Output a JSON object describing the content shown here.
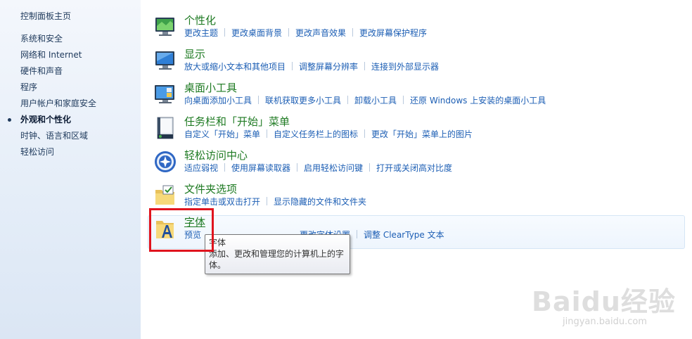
{
  "sidebar": {
    "home": "控制面板主页",
    "items": [
      {
        "label": "系统和安全"
      },
      {
        "label": "网络和 Internet"
      },
      {
        "label": "硬件和声音"
      },
      {
        "label": "程序"
      },
      {
        "label": "用户帐户和家庭安全"
      },
      {
        "label": "外观和个性化"
      },
      {
        "label": "时钟、语言和区域"
      },
      {
        "label": "轻松访问"
      }
    ]
  },
  "categories": [
    {
      "title": "个性化",
      "icon": "personalization-icon",
      "links": [
        "更改主题",
        "更改桌面背景",
        "更改声音效果",
        "更改屏幕保护程序"
      ]
    },
    {
      "title": "显示",
      "icon": "display-icon",
      "links": [
        "放大或缩小文本和其他项目",
        "调整屏幕分辨率",
        "连接到外部显示器"
      ]
    },
    {
      "title": "桌面小工具",
      "icon": "gadgets-icon",
      "links": [
        "向桌面添加小工具",
        "联机获取更多小工具",
        "卸载小工具",
        "还原 Windows 上安装的桌面小工具"
      ]
    },
    {
      "title": "任务栏和「开始」菜单",
      "icon": "taskbar-icon",
      "links": [
        "自定义「开始」菜单",
        "自定义任务栏上的图标",
        "更改「开始」菜单上的图片"
      ]
    },
    {
      "title": "轻松访问中心",
      "icon": "ease-of-access-icon",
      "links": [
        "适应弱视",
        "使用屏幕读取器",
        "启用轻松访问键",
        "打开或关闭高对比度"
      ]
    },
    {
      "title": "文件夹选项",
      "icon": "folder-options-icon",
      "links": [
        "指定单击或双击打开",
        "显示隐藏的文件和文件夹"
      ]
    },
    {
      "title": "字体",
      "icon": "fonts-icon",
      "links": [
        "预览、删除或者显示和隐藏字体",
        "更改字体设置",
        "调整 ClearType 文本"
      ]
    }
  ],
  "fonts_visible_links": [
    "预览",
    "更改字体设置",
    "调整 ClearType 文本"
  ],
  "tooltip": {
    "title": "字体",
    "body": "添加、更改和管理您的计算机上的字体。"
  },
  "watermark": {
    "logo": "Baidu经验",
    "url": "jingyan.baidu.com"
  },
  "colors": {
    "category_title": "#1e7a22",
    "link": "#1c5eb4",
    "highlight": "#e0141e"
  }
}
